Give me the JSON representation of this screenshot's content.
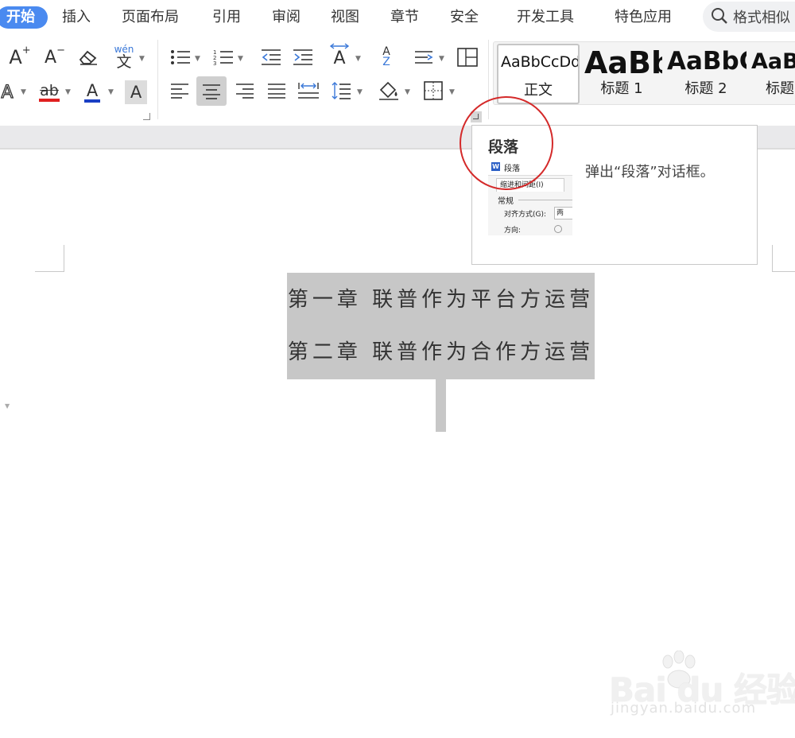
{
  "tabs": {
    "items": [
      "开始",
      "插入",
      "页面布局",
      "引用",
      "审阅",
      "视图",
      "章节",
      "安全",
      "开发工具",
      "特色应用"
    ],
    "search_text": "格式相似"
  },
  "ribbon": {
    "font_grow_label": "A",
    "font_grow_sup": "+",
    "font_shrink_label": "A",
    "font_shrink_sup": "−",
    "pinyin_top": "wén",
    "pinyin_char": "文",
    "text_effect_label": "A",
    "highlight_label": "ab",
    "font_color_label": "A",
    "char_shading_label": "A",
    "spacing_label": "A",
    "sort_letters": [
      "A",
      "Z"
    ],
    "colors": {
      "highlight": "#e02020",
      "font_color": "#1a3fc4",
      "accent_blue": "#3a78d8"
    }
  },
  "styles": [
    {
      "preview": "AaBbCcDd",
      "name": "正文",
      "selected": true
    },
    {
      "preview": "AaBb",
      "name": "标题 1",
      "selected": false
    },
    {
      "preview": "AaBbC",
      "name": "标题 2",
      "selected": false
    },
    {
      "preview": "AaBb",
      "name": "标题",
      "selected": false
    }
  ],
  "tooltip": {
    "title": "段落",
    "description": "弹出“段落”对话框。",
    "mini_dialog": {
      "title": "段落",
      "tab": "缩进和间距(I)",
      "group": "常规",
      "align_label": "对齐方式(G):",
      "align_value": "两",
      "direction_label": "方向:"
    }
  },
  "document": {
    "lines": [
      "第一章  联普作为平台方运营",
      "第二章  联普作为合作方运营"
    ]
  },
  "watermark": {
    "brand": "Bai du 经验",
    "url": "jingyan.baidu.com"
  }
}
